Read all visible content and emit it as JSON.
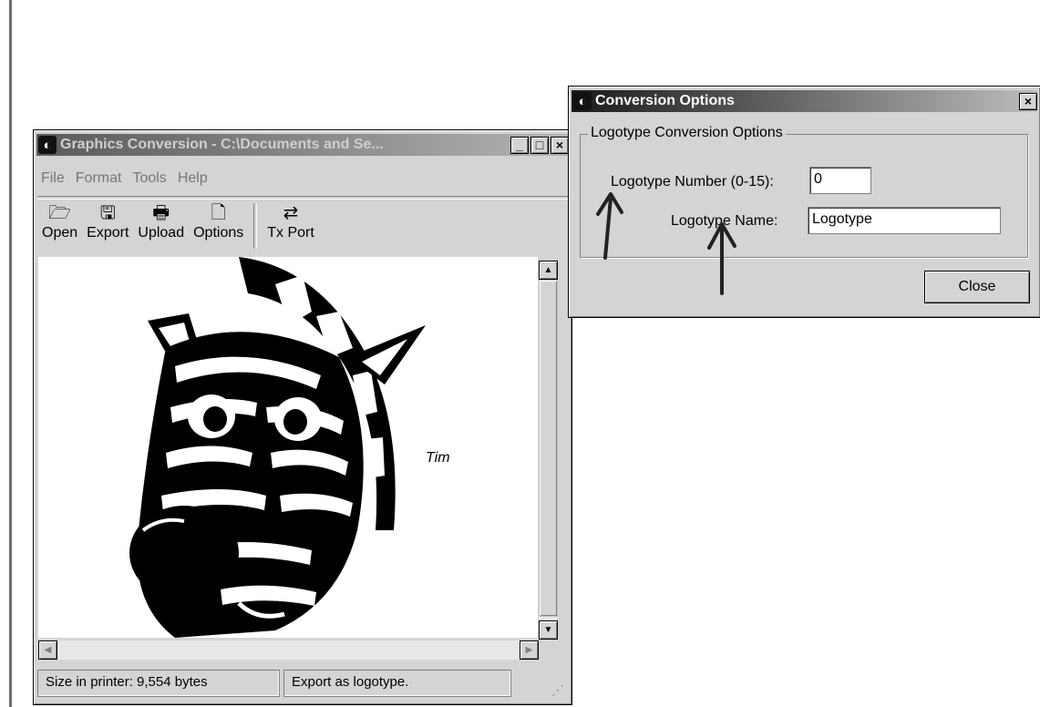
{
  "main_window": {
    "title": "Graphics Conversion - C:\\Documents and Se...",
    "controls": {
      "minimize": "_",
      "maximize": "□",
      "close": "×"
    },
    "menu": [
      "File",
      "Format",
      "Tools",
      "Help"
    ],
    "toolbar": [
      {
        "label": "Open",
        "icon": "open-folder-icon",
        "glyph": "🗁"
      },
      {
        "label": "Export",
        "icon": "floppy-disk-icon",
        "glyph": "🖫"
      },
      {
        "label": "Upload",
        "icon": "printer-icon",
        "glyph": "🖶"
      },
      {
        "label": "Options",
        "icon": "page-icon",
        "glyph": "🗋"
      },
      {
        "label": "Tx Port",
        "icon": "port-icon",
        "glyph": "⇄"
      }
    ],
    "canvas_annotation": "Tim",
    "status": {
      "size": "Size in printer: 9,554 bytes",
      "mode": "Export as logotype."
    }
  },
  "dialog": {
    "title": "Conversion Options",
    "close": "×",
    "group_label": "Logotype Conversion Options",
    "number_label": "Logotype Number (0-15):",
    "number_value": "0",
    "name_label": "Logotype Name:",
    "name_value": "Logotype",
    "close_button": "Close"
  }
}
